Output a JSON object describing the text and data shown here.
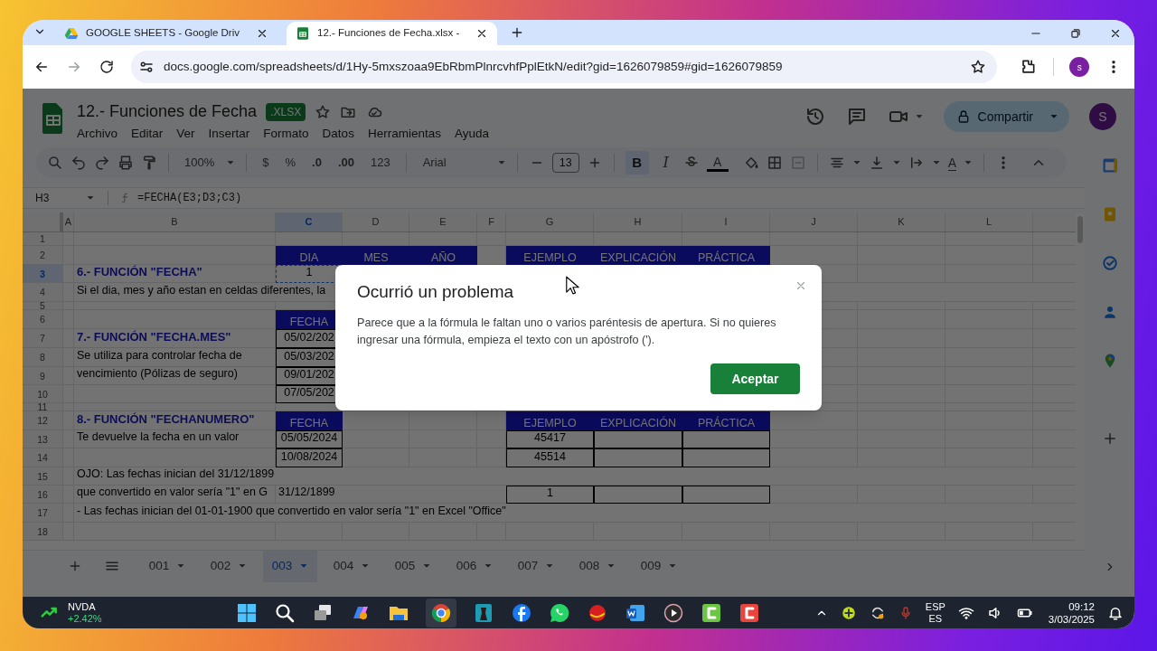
{
  "browser": {
    "tabs": [
      {
        "title": "GOOGLE SHEETS - Google Driv",
        "selected": false
      },
      {
        "title": "12.- Funciones de Fecha.xlsx -",
        "selected": true
      }
    ],
    "url": "docs.google.com/spreadsheets/d/1Hy-5mxszoaa9EbRbmPlnrcvhfPplEtkN/edit?gid=1626079859#gid=1626079859",
    "profile_initial": "s"
  },
  "document": {
    "title": "12.- Funciones de Fecha",
    "badge": ".XLSX",
    "menus": [
      "Archivo",
      "Editar",
      "Ver",
      "Insertar",
      "Formato",
      "Datos",
      "Herramientas",
      "Ayuda"
    ],
    "share_button": "Compartir",
    "avatar_initial": "S"
  },
  "toolbar": {
    "zoom": "100%",
    "currency": "$",
    "percent": "%",
    "decrease_decimals": ".0",
    "increase_decimals": ".00",
    "number_format": "123",
    "font": "Arial",
    "font_size": "13",
    "bold": {
      "label": "B",
      "on": true
    },
    "italic": "I",
    "text_color": "A",
    "text_rotation": "A"
  },
  "formula_bar": {
    "cell": "H3",
    "formula": "=FECHA(E3;D3;C3)"
  },
  "sheet": {
    "columns": [
      {
        "label": "A",
        "selected": false
      },
      {
        "label": "B",
        "selected": false
      },
      {
        "label": "C",
        "selected": true
      },
      {
        "label": "D",
        "selected": false
      },
      {
        "label": "E",
        "selected": false
      },
      {
        "label": "F",
        "selected": false
      },
      {
        "label": "G",
        "selected": false
      },
      {
        "label": "H",
        "selected": false
      },
      {
        "label": "I",
        "selected": false
      },
      {
        "label": "J",
        "selected": false
      },
      {
        "label": "K",
        "selected": false
      },
      {
        "label": "L",
        "selected": false
      }
    ],
    "rows": [
      {
        "number": "1",
        "selected": false
      },
      {
        "number": "2",
        "selected": false,
        "cells": [
          null,
          null,
          {
            "kind": "header",
            "text": "DIA"
          },
          {
            "kind": "header",
            "text": "MES"
          },
          {
            "kind": "header",
            "text": "AÑO"
          },
          null,
          {
            "kind": "header",
            "text": "EJEMPLO"
          },
          {
            "kind": "header",
            "text": "EXPLICACIÓN"
          },
          {
            "kind": "header",
            "text": "PRÁCTICA"
          }
        ]
      },
      {
        "number": "3",
        "selected": true,
        "cells": [
          null,
          {
            "kind": "heading",
            "text": "6.- FUNCIÓN \"FECHA\""
          },
          {
            "kind": "active",
            "text": "1"
          }
        ]
      },
      {
        "number": "4",
        "selected": false,
        "cells": [
          null,
          {
            "kind": "text",
            "text": "Si el dia, mes y año estan en celdas diferentes, la"
          }
        ]
      },
      {
        "number": "5",
        "selected": false
      },
      {
        "number": "6",
        "selected": false,
        "cells": [
          null,
          null,
          {
            "kind": "header",
            "text": "FECHA"
          }
        ]
      },
      {
        "number": "7",
        "selected": false,
        "cells": [
          null,
          {
            "kind": "heading",
            "text": "7.- FUNCIÓN \"FECHA.MES\""
          },
          {
            "kind": "boxed",
            "text": "05/02/202"
          }
        ]
      },
      {
        "number": "8",
        "selected": false,
        "cells": [
          null,
          {
            "kind": "text",
            "text": "Se utiliza para controlar fecha de"
          },
          {
            "kind": "boxed",
            "text": "05/03/202"
          }
        ]
      },
      {
        "number": "9",
        "selected": false,
        "cells": [
          null,
          {
            "kind": "text",
            "text": "vencimiento (Pólizas de seguro)"
          },
          {
            "kind": "boxed",
            "text": "09/01/202"
          }
        ]
      },
      {
        "number": "10",
        "selected": false,
        "cells": [
          null,
          null,
          {
            "kind": "boxed",
            "text": "07/05/202"
          }
        ]
      },
      {
        "number": "11",
        "selected": false
      },
      {
        "number": "12",
        "selected": false,
        "cells": [
          null,
          {
            "kind": "heading",
            "text": "8.- FUNCIÓN \"FECHANUMERO\""
          },
          {
            "kind": "header",
            "text": "FECHA"
          },
          null,
          null,
          null,
          {
            "kind": "header",
            "text": "EJEMPLO"
          },
          {
            "kind": "header",
            "text": "EXPLICACIÓN"
          },
          {
            "kind": "header",
            "text": "PRÁCTICA"
          }
        ]
      },
      {
        "number": "13",
        "selected": false,
        "cells": [
          null,
          {
            "kind": "text",
            "text": "Te devuelve la fecha en un valor"
          },
          {
            "kind": "boxed",
            "text": "05/05/2024"
          },
          null,
          null,
          null,
          {
            "kind": "boxed",
            "text": "45417"
          },
          {
            "kind": "boxed"
          },
          {
            "kind": "boxed"
          }
        ]
      },
      {
        "number": "14",
        "selected": false,
        "cells": [
          null,
          null,
          {
            "kind": "boxed",
            "text": "10/08/2024"
          },
          null,
          null,
          null,
          {
            "kind": "boxed",
            "text": "45514"
          },
          {
            "kind": "boxed"
          },
          {
            "kind": "boxed"
          }
        ]
      },
      {
        "number": "15",
        "selected": false,
        "cells": [
          null,
          {
            "kind": "text",
            "text": "OJO: Las fechas inician del 31/12/1899"
          }
        ]
      },
      {
        "number": "16",
        "selected": false,
        "cells": [
          null,
          {
            "kind": "text",
            "text": "que convertido en valor sería \"1\" en G"
          },
          {
            "kind": "text",
            "text": "31/12/1899"
          },
          null,
          null,
          null,
          {
            "kind": "boxed",
            "text": "1"
          },
          {
            "kind": "boxed"
          },
          {
            "kind": "boxed"
          }
        ]
      },
      {
        "number": "17",
        "selected": false,
        "cells": [
          null,
          {
            "kind": "text",
            "text": "- Las fechas inician del 01-01-1900 que convertido en valor sería \"1\" en Excel \"Office\""
          }
        ]
      },
      {
        "number": "18",
        "selected": false
      }
    ]
  },
  "sheet_tabs": [
    {
      "label": "001",
      "selected": false
    },
    {
      "label": "002",
      "selected": false
    },
    {
      "label": "003",
      "selected": true
    },
    {
      "label": "004",
      "selected": false
    },
    {
      "label": "005",
      "selected": false
    },
    {
      "label": "006",
      "selected": false
    },
    {
      "label": "007",
      "selected": false
    },
    {
      "label": "008",
      "selected": false
    },
    {
      "label": "009",
      "selected": false
    }
  ],
  "dialog": {
    "title": "Ocurrió un problema",
    "message": "Parece que a la fórmula le faltan uno o varios paréntesis de apertura. Si no quieres ingresar una fórmula, empieza el texto con un apóstrofo (').",
    "button": "Aceptar"
  },
  "taskbar": {
    "stock": {
      "ticker": "NVDA",
      "change": "+2.42%"
    },
    "input_language": "ESP",
    "keyboard_layout": "ES",
    "time": "09:12",
    "date": "3/03/2025"
  }
}
